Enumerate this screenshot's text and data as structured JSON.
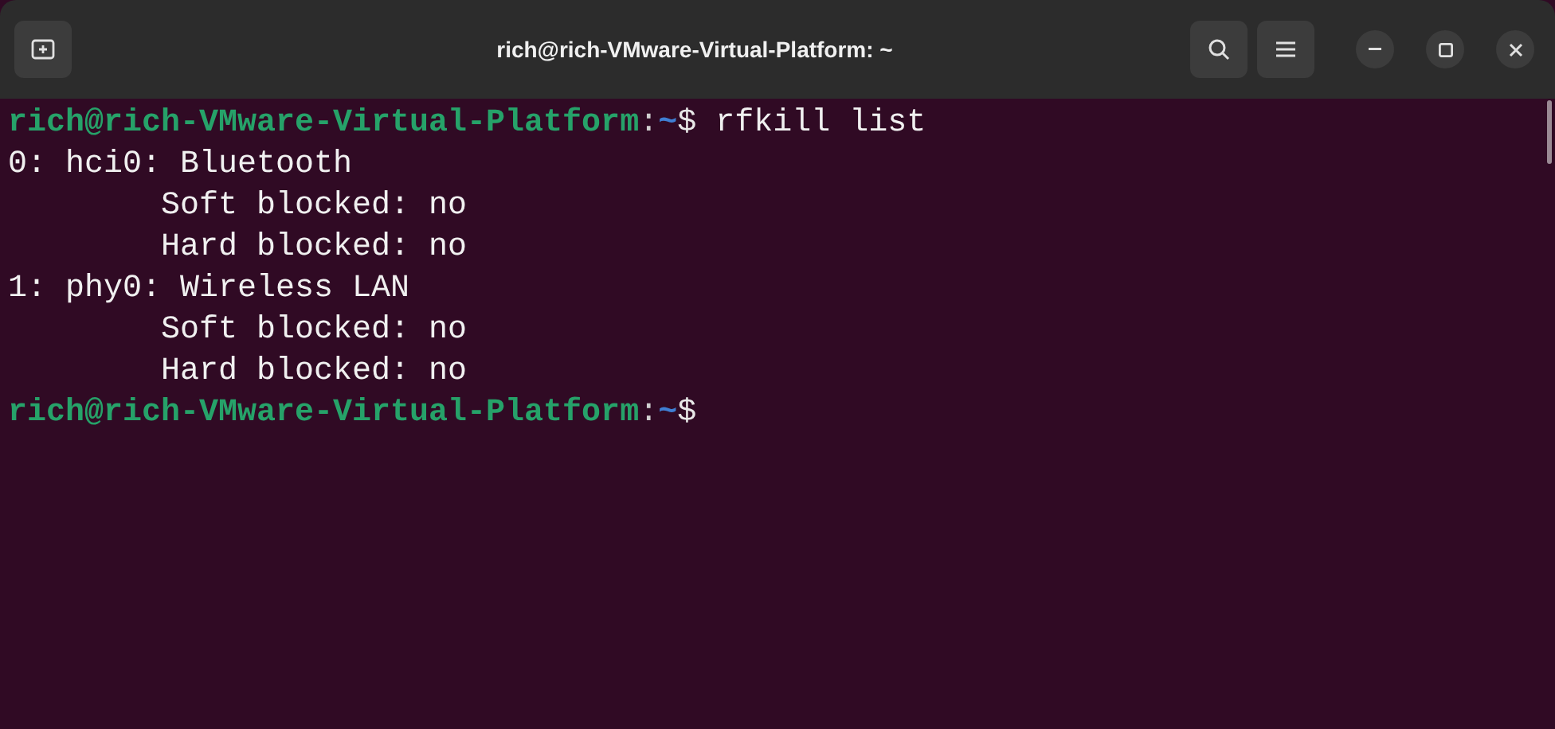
{
  "window": {
    "title": "rich@rich-VMware-Virtual-Platform: ~"
  },
  "terminal": {
    "lines": [
      {
        "kind": "prompt",
        "user_host": "rich@rich-VMware-Virtual-Platform",
        "separator": ":",
        "path": "~",
        "symbol": "$",
        "command": " rfkill list"
      },
      {
        "kind": "output",
        "text": "0: hci0: Bluetooth"
      },
      {
        "kind": "output",
        "text": "\tSoft blocked: no"
      },
      {
        "kind": "output",
        "text": "\tHard blocked: no"
      },
      {
        "kind": "output",
        "text": "1: phy0: Wireless LAN"
      },
      {
        "kind": "output",
        "text": "\tSoft blocked: no"
      },
      {
        "kind": "output",
        "text": "\tHard blocked: no"
      },
      {
        "kind": "prompt",
        "user_host": "rich@rich-VMware-Virtual-Platform",
        "separator": ":",
        "path": "~",
        "symbol": "$"
      }
    ]
  }
}
